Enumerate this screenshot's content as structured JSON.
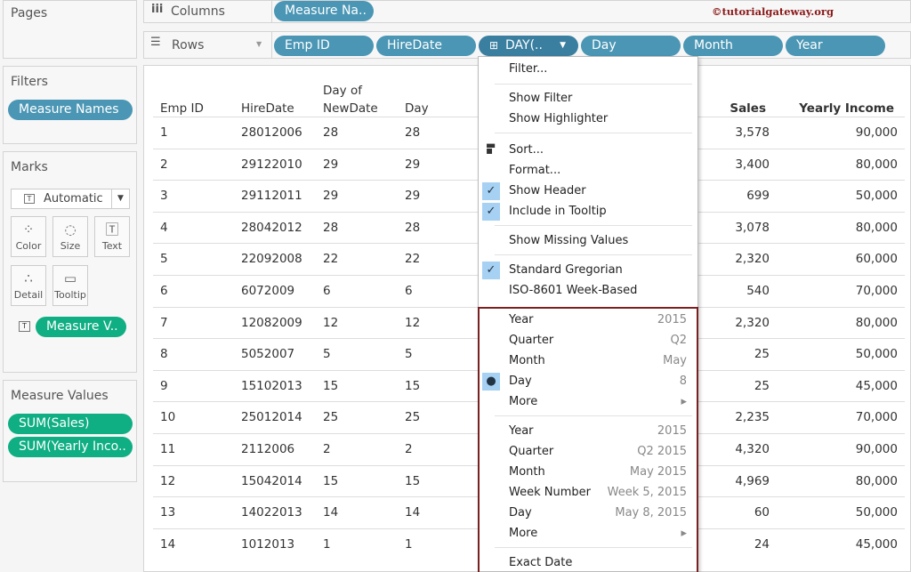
{
  "pages": {
    "title": "Pages"
  },
  "filters": {
    "title": "Filters",
    "pills": [
      "Measure Names"
    ]
  },
  "marks": {
    "title": "Marks",
    "type": "Automatic",
    "cards": [
      "Color",
      "Size",
      "Text",
      "Detail",
      "Tooltip"
    ],
    "text_pill": "Measure V.."
  },
  "measure_values": {
    "title": "Measure Values",
    "pills": [
      "SUM(Sales)",
      "SUM(Yearly Inco.."
    ]
  },
  "columns": {
    "label": "Columns",
    "pills": [
      "Measure Na.."
    ]
  },
  "rows": {
    "label": "Rows",
    "pills": [
      "Emp ID",
      "HireDate",
      "DAY(..",
      "Day",
      "Month",
      "Year"
    ]
  },
  "watermark": "©tutorialgateway.org",
  "table": {
    "headers": {
      "emp": "Emp ID",
      "hire": "HireDate",
      "dayof1": "Day of",
      "dayof2": "NewDate",
      "day": "Day",
      "sales": "Sales",
      "income": "Yearly Income"
    },
    "rows": [
      [
        "1",
        "28012006",
        "28",
        "28",
        "3,578",
        "90,000"
      ],
      [
        "2",
        "29122010",
        "29",
        "29",
        "3,400",
        "80,000"
      ],
      [
        "3",
        "29112011",
        "29",
        "29",
        "699",
        "50,000"
      ],
      [
        "4",
        "28042012",
        "28",
        "28",
        "3,078",
        "80,000"
      ],
      [
        "5",
        "22092008",
        "22",
        "22",
        "2,320",
        "60,000"
      ],
      [
        "6",
        "6072009",
        "6",
        "6",
        "540",
        "70,000"
      ],
      [
        "7",
        "12082009",
        "12",
        "12",
        "2,320",
        "80,000"
      ],
      [
        "8",
        "5052007",
        "5",
        "5",
        "25",
        "50,000"
      ],
      [
        "9",
        "15102013",
        "15",
        "15",
        "25",
        "45,000"
      ],
      [
        "10",
        "25012014",
        "25",
        "25",
        "2,235",
        "70,000"
      ],
      [
        "11",
        "2112006",
        "2",
        "2",
        "4,320",
        "90,000"
      ],
      [
        "12",
        "15042014",
        "15",
        "15",
        "4,969",
        "80,000"
      ],
      [
        "13",
        "14022013",
        "14",
        "14",
        "60",
        "50,000"
      ],
      [
        "14",
        "1012013",
        "1",
        "1",
        "24",
        "45,000"
      ]
    ]
  },
  "menu": {
    "filter": "Filter...",
    "show_filter": "Show Filter",
    "show_highlighter": "Show Highlighter",
    "sort": "Sort...",
    "format": "Format...",
    "show_header": "Show Header",
    "include_tooltip": "Include in Tooltip",
    "show_missing": "Show Missing Values",
    "gregorian": "Standard Gregorian",
    "iso": "ISO-8601 Week-Based",
    "discrete": [
      {
        "label": "Year",
        "value": "2015"
      },
      {
        "label": "Quarter",
        "value": "Q2"
      },
      {
        "label": "Month",
        "value": "May"
      },
      {
        "label": "Day",
        "value": "8"
      },
      {
        "label": "More",
        "value": "▸"
      }
    ],
    "continuous": [
      {
        "label": "Year",
        "value": "2015"
      },
      {
        "label": "Quarter",
        "value": "Q2 2015"
      },
      {
        "label": "Month",
        "value": "May 2015"
      },
      {
        "label": "Week Number",
        "value": "Week 5, 2015"
      },
      {
        "label": "Day",
        "value": "May 8, 2015"
      },
      {
        "label": "More",
        "value": "▸"
      }
    ],
    "exact_date": "Exact Date"
  }
}
